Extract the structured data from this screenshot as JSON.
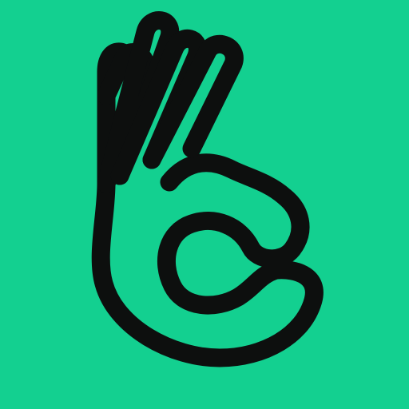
{
  "icon": {
    "name": "ok-hand-icon",
    "background_color": "#13d090",
    "stroke_color": "#0d0f0e"
  }
}
